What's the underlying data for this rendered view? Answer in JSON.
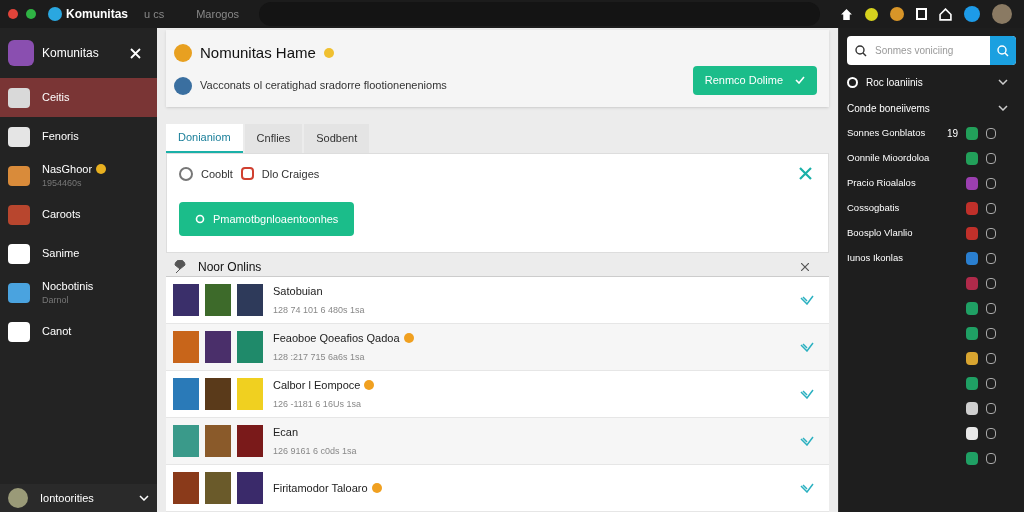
{
  "topbar": {
    "brand": "Komunitas",
    "links": [
      "u cs",
      "Marogos"
    ]
  },
  "sidebar": {
    "title": "Komunitas",
    "items": [
      {
        "label": "Ceitis",
        "emoji": false,
        "selected": true,
        "color": "#d9d9d9"
      },
      {
        "label": "Fenoris",
        "emoji": false,
        "selected": false,
        "color": "#e5e5e5"
      },
      {
        "label": "NasGhoor",
        "sub": "1954460s",
        "emoji": true,
        "selected": false,
        "color": "#d98b3a"
      },
      {
        "label": "Caroots",
        "emoji": false,
        "selected": false,
        "color": "#b8462e"
      },
      {
        "label": "Sanime",
        "emoji": false,
        "selected": false,
        "color": "#ffffff"
      },
      {
        "label": "Nocbotinis",
        "sub": "Darnol",
        "emoji": false,
        "selected": false,
        "color": "#4aa3df"
      },
      {
        "label": "Canot",
        "emoji": false,
        "selected": false,
        "color": "#ffffff"
      }
    ],
    "footer": "Iontoorities"
  },
  "header": {
    "title": "Nomunitas Hame",
    "description": "Vacconats ol ceratighad sradorre flootionenenioms",
    "button": "Renmco Dolime"
  },
  "tabs": [
    {
      "label": "Donianiom",
      "selected": true
    },
    {
      "label": "Cnflies",
      "selected": false
    },
    {
      "label": "Sodbent",
      "selected": false
    }
  ],
  "form": {
    "option": "Cooblt",
    "option_checked": false,
    "source": "Dlo Craiges",
    "button": "Pmamotbgnloaentoonhes"
  },
  "section": {
    "title": "Noor Onlins"
  },
  "rows": [
    {
      "title": "Satobuian",
      "meta": "128 74 101 6 480s 1sa",
      "emoji": false
    },
    {
      "title": "Feaoboe Qoeafios Qadoa",
      "meta": "128 :217 715 6a6s 1sa",
      "emoji": true
    },
    {
      "title": "Calbor l Eompoce",
      "meta": "126 -1181 6 16Us 1sa",
      "emoji": true
    },
    {
      "title": "Ecan",
      "meta": "126 9161 6 c0ds 1sa",
      "emoji": false
    },
    {
      "title": "Firitamodor Taloaro",
      "emoji": true
    }
  ],
  "right": {
    "search": {
      "placeholder": "Sonmes voniciing"
    },
    "groups": [
      {
        "label": "Roc loaniinis",
        "expanded": false
      },
      {
        "label": "Conde boneiivems",
        "expanded": false
      }
    ],
    "apps": [
      {
        "label": "Sonnes Gonblatos",
        "count": "19",
        "color": "#22a05a"
      },
      {
        "label": "Oonnile Mioordoloa",
        "color": "#22a05a"
      },
      {
        "label": "Pracio Rioalalos",
        "color": "#9b3fb0"
      },
      {
        "label": "Cossogbatis",
        "color": "#c0302a"
      },
      {
        "label": "Boosplo Vlanlio",
        "color": "#c0302a"
      },
      {
        "label": "Iunos Ikonlas",
        "color": "#2a7fd0"
      },
      {
        "color": "#b02a4a"
      },
      {
        "color": "#1fa064"
      },
      {
        "color": "#1fa064"
      },
      {
        "color": "#d9a530"
      },
      {
        "color": "#1fa064"
      },
      {
        "color": "#cfcfcf"
      },
      {
        "color": "#e8e8e8"
      },
      {
        "color": "#1fa064"
      }
    ]
  }
}
